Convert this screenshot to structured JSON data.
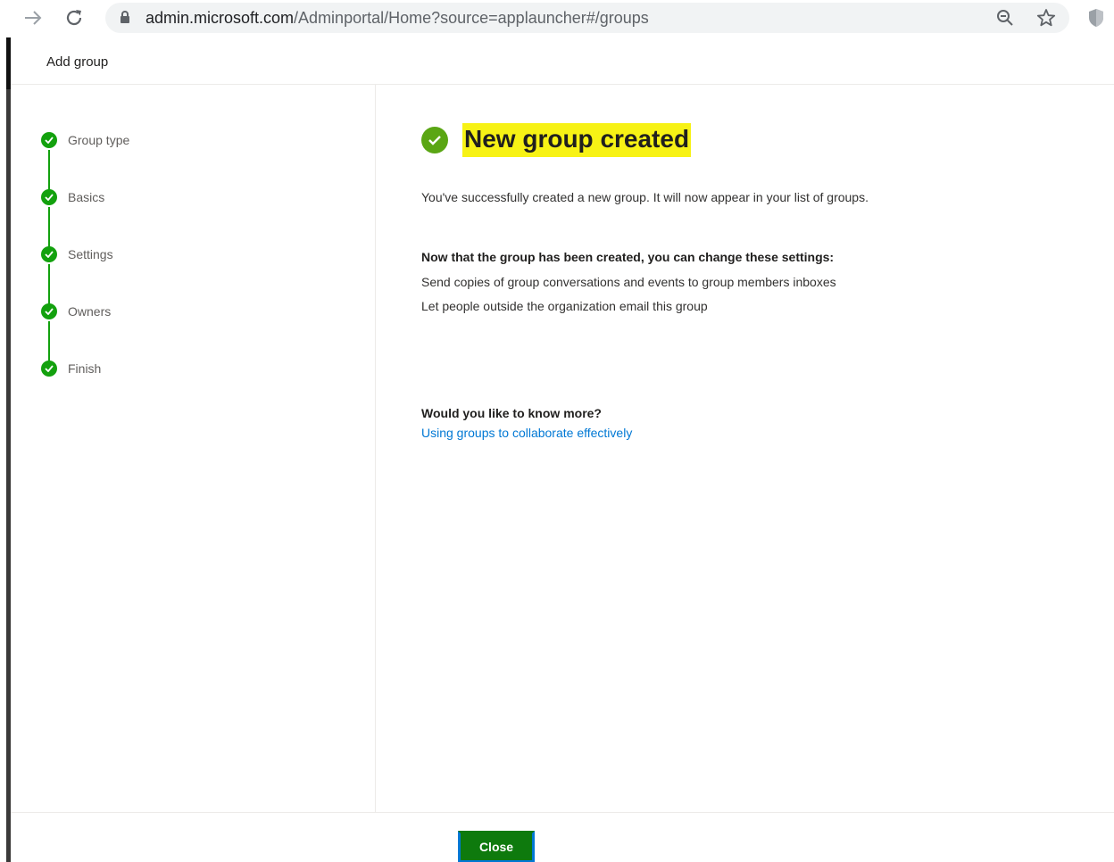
{
  "browser": {
    "url_host": "admin.microsoft.com",
    "url_path": "/Adminportal/Home?source=applauncher#/groups",
    "icons": {
      "forward": "forward-arrow-icon",
      "reload": "reload-icon",
      "lock": "lock-icon",
      "zoom": "zoom-icon",
      "bookmark": "star-icon",
      "extension": "shield-extension-icon"
    }
  },
  "panel": {
    "title": "Add group"
  },
  "steps": [
    {
      "label": "Group type",
      "status": "complete"
    },
    {
      "label": "Basics",
      "status": "complete"
    },
    {
      "label": "Settings",
      "status": "complete"
    },
    {
      "label": "Owners",
      "status": "complete"
    },
    {
      "label": "Finish",
      "status": "complete"
    }
  ],
  "content": {
    "heading": "New group created",
    "success_message": "You've successfully created a new group. It will now appear in your list of groups.",
    "settings_heading": "Now that the group has been created, you can change these settings:",
    "settings": [
      "Send copies of group conversations and events to group members inboxes",
      "Let people outside the organization email this group"
    ],
    "know_more_heading": "Would you like to know more?",
    "link_text": "Using groups to collaborate effectively"
  },
  "footer": {
    "close_label": "Close"
  },
  "colors": {
    "success_green": "#13a10e",
    "highlight_yellow": "#f7f215",
    "link_blue": "#0078d4",
    "button_green": "#0e7a0d"
  }
}
